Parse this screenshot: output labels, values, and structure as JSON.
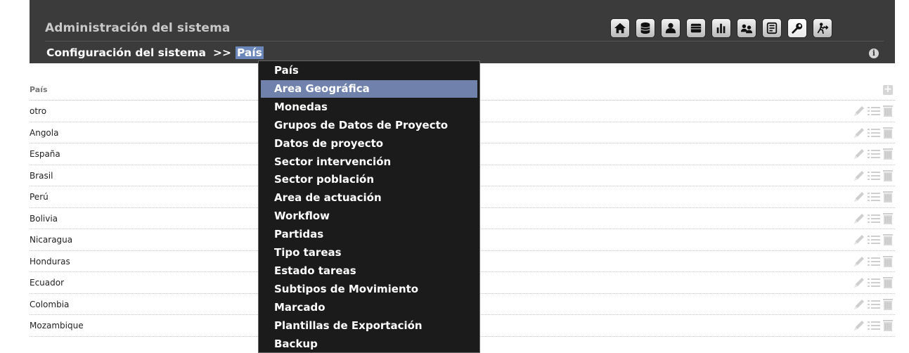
{
  "header": {
    "title": "Administración del sistema",
    "breadcrumb": {
      "section": "Configuración del sistema",
      "separator": ">>",
      "current": "País"
    },
    "toolbar": [
      {
        "name": "home-icon"
      },
      {
        "name": "database-icon"
      },
      {
        "name": "users-icon"
      },
      {
        "name": "folder-icon"
      },
      {
        "name": "chart-icon"
      },
      {
        "name": "user-group-icon"
      },
      {
        "name": "report-icon"
      },
      {
        "name": "tools-icon"
      },
      {
        "name": "logout-icon"
      }
    ]
  },
  "table": {
    "column": "País",
    "rows": [
      "otro",
      "Angola",
      "España",
      "Brasil",
      "Perú",
      "Bolivia",
      "Nicaragua",
      "Honduras",
      "Ecuador",
      "Colombia",
      "Mozambique"
    ]
  },
  "menu": {
    "items": [
      "País",
      "Area Geográfica",
      "Monedas",
      "Grupos de Datos de Proyecto",
      "Datos de proyecto",
      "Sector intervención",
      "Sector población",
      "Area de actuación",
      "Workflow",
      "Partidas",
      "Tipo tareas",
      "Estado tareas",
      "Subtipos de Movimiento",
      "Marcado",
      "Plantillas de Exportación",
      "Backup"
    ],
    "highlighted_index": 1
  },
  "colors": {
    "header_bg": "#3b3b3b",
    "menu_bg": "#1b1b1b",
    "menu_highlight": "#7082ac",
    "breadcrumb_highlight": "#6b86b8"
  }
}
